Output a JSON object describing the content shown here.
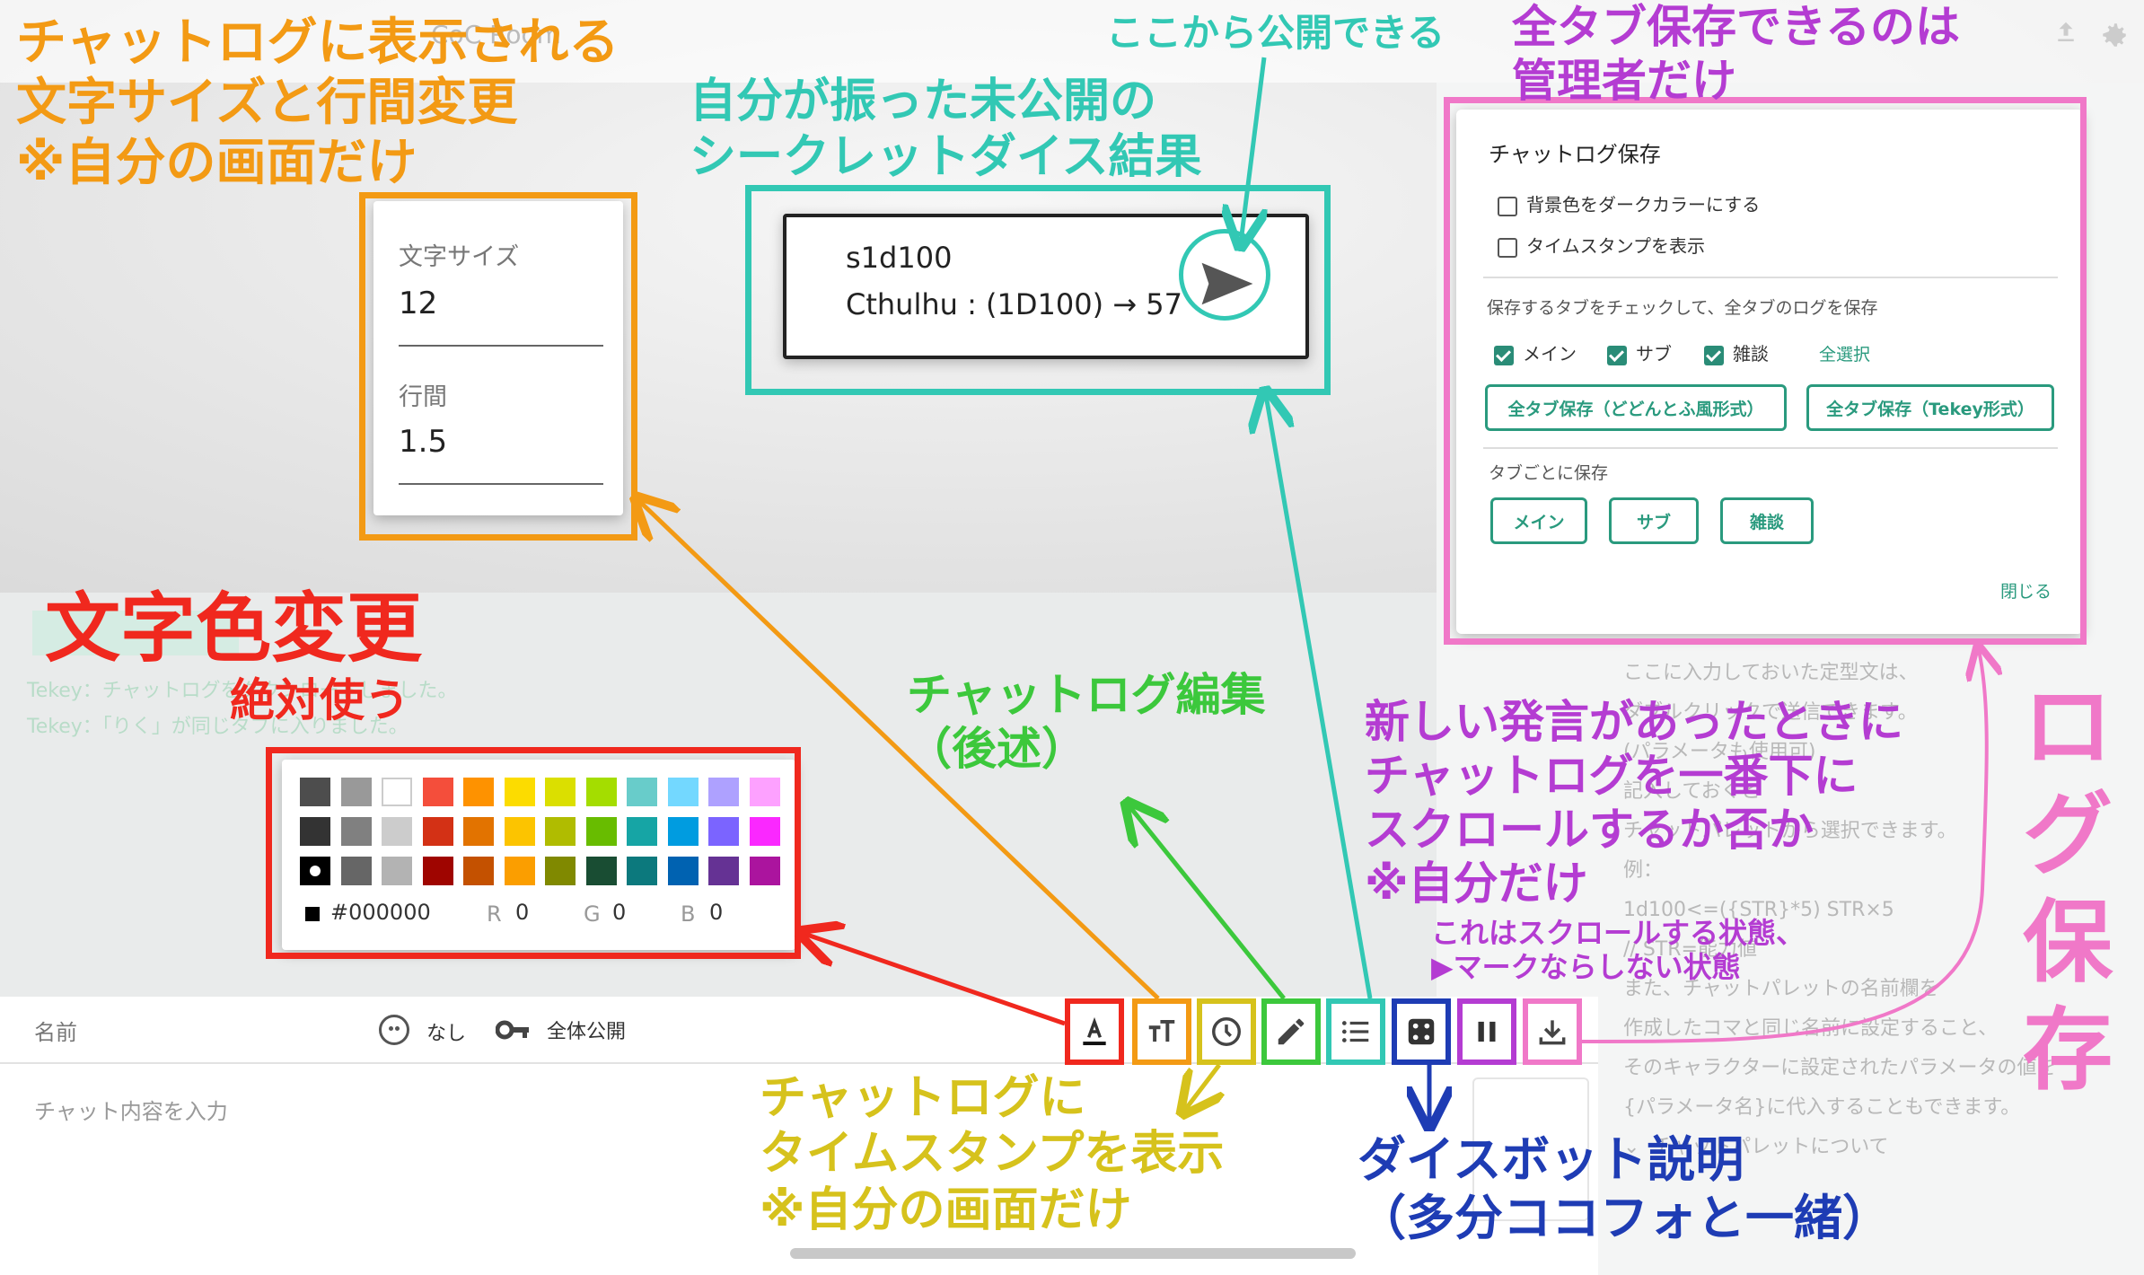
{
  "topbar": {
    "title": "CoC Room"
  },
  "chat_log": [
    "Tekey：チャットログをダウンロードしました。",
    "Tekey：「りく」が同じタブに入りました。"
  ],
  "input": {
    "name_label": "名前",
    "face_label": "なし",
    "visibility_label": "全体公開",
    "placeholder": "チャット内容を入力"
  },
  "right_panel": {
    "text": "ここに入力しておいた定型文は、\nダブルクリックで送信できます。\n(パラメータも使用可)\n記入しておくと\nチャットパレットから選択できます。\n例：\n1d100<=({STR}*5) STR×5\n// STR=能力値\nまた、チャットパレットの名前欄を\n作成したコマと同じ名前に設定すること、\nそのキャラクターに設定されたパラメータの値を\n{パラメータ名}に代入することもできます。\n⌄  チャットパレットについて"
  },
  "font_panel": {
    "size_label": "文字サイズ",
    "size_value": "12",
    "line_label": "行間",
    "line_value": "1.5"
  },
  "color_panel": {
    "hex": "#000000",
    "r_label": "R",
    "r_value": "0",
    "g_label": "G",
    "g_value": "0",
    "b_label": "B",
    "b_value": "0",
    "rows": [
      [
        "#4d4d4d",
        "#999999",
        "#ffffff",
        "#f44e3b",
        "#fe9200",
        "#fcdc00",
        "#dbdf00",
        "#a4dd00",
        "#68ccca",
        "#73d8ff",
        "#aea1ff",
        "#fda1ff"
      ],
      [
        "#333333",
        "#808080",
        "#cccccc",
        "#d33115",
        "#e27300",
        "#fcc400",
        "#b0bc00",
        "#68bc00",
        "#16a5a5",
        "#009ce0",
        "#7b64ff",
        "#fa28ff"
      ],
      [
        "#000000",
        "#666666",
        "#b3b3b3",
        "#9f0500",
        "#c45100",
        "#fb9e00",
        "#808900",
        "#194d33",
        "#0c797d",
        "#0062b1",
        "#653294",
        "#ab149e"
      ]
    ]
  },
  "secret_panel": {
    "command": "s1d100",
    "result": "Cthulhu : (1D100) → 57"
  },
  "log_panel": {
    "title": "チャットログ保存",
    "option_dark": "背景色をダークカラーにする",
    "option_timestamp": "タイムスタンプを表示",
    "section_all": "保存するタブをチェックして、全タブのログを保存",
    "tabs": [
      "メイン",
      "サブ",
      "雑談"
    ],
    "select_all": "全選択",
    "btn_dodontof": "全タブ保存（どどんとふ風形式）",
    "btn_tekey": "全タブ保存（Tekey形式）",
    "section_each": "タブごとに保存",
    "close": "閉じる"
  },
  "annotations": {
    "font": "チャットログに表示される\n文字サイズと行間変更\n※自分の画面だけ",
    "secret_title": "自分が振った未公開の\nシークレットダイス結果",
    "publish": "ここから公開できる",
    "admin": "全タブ保存できるのは\n管理者だけ",
    "color_title": "文字色変更",
    "color_sub": "絶対使う",
    "edit": "チャットログ編集\n（後述）",
    "scroll": "新しい発言があったときに\nチャットログを一番下に\nスクロールするか否か\n※自分だけ",
    "pause": "これはスクロールする状態、\n▶マークならしない状態",
    "log_save": "ログ\n保存",
    "timestamp": "チャットログに\nタイムスタンプを表示\n※自分の画面だけ",
    "dice": "ダイスボット説明\n（多分ココフォと一緒）"
  },
  "colors": {
    "red": "#f0281e",
    "orange": "#f39a14",
    "yellow": "#d6c21c",
    "green": "#3cc83c",
    "teal": "#32c8b4",
    "navy": "#1e3cb4",
    "purple": "#b43cd2",
    "pink": "#f078c8"
  }
}
